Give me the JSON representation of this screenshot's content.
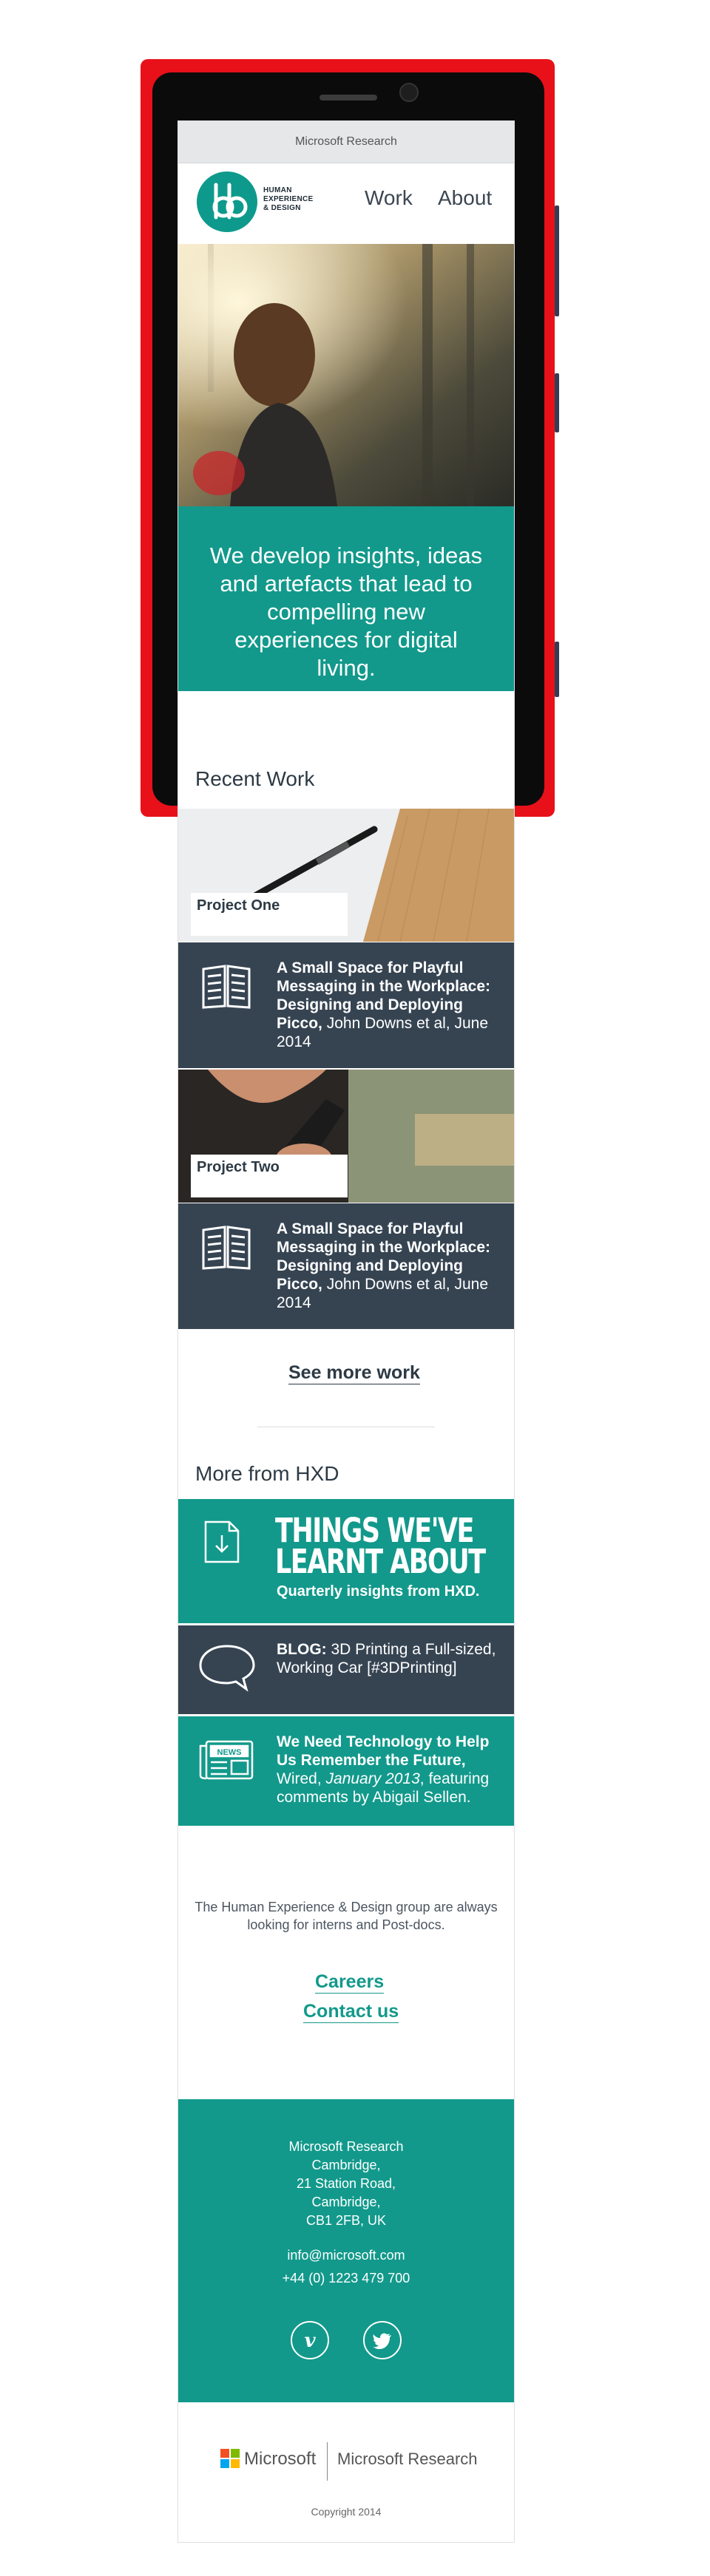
{
  "browser": {
    "title": "Microsoft Research"
  },
  "header": {
    "logo_text": [
      "HUMAN",
      "EXPERIENCE",
      "& DESIGN"
    ],
    "nav": [
      {
        "label": "Work"
      },
      {
        "label": "About"
      }
    ]
  },
  "hero": {
    "tagline": "We develop insights, ideas and artefacts that lead to compelling new experiences for digital living."
  },
  "recent_work": {
    "title": "Recent Work",
    "projects": [
      {
        "label": "Project One",
        "paper_title": "A Small Space for Playful Messaging in the Workplace: Designing and Deploying Picco,",
        "paper_meta": " John Downs et al, June 2014",
        "icon": "book-icon"
      },
      {
        "label": "Project Two",
        "paper_title": "A Small Space for Playful Messaging in the Workplace: Designing and Deploying Picco,",
        "paper_meta": " John Downs et al, June 2014",
        "icon": "book-icon"
      }
    ],
    "see_more": "See more work"
  },
  "more": {
    "title": "More from HXD",
    "things_title_1": "THINGS WE'VE",
    "things_title_2": "LEARNT ABOUT",
    "things_sub": "Quarterly insights from HXD.",
    "blog_label": "BLOG:",
    "blog_text": " 3D Printing a Full-sized, Working Car [#3DPrinting]",
    "news_title": "We Need Technology to Help Us Remember the Future,",
    "news_source": " Wired, ",
    "news_date": "January 2013",
    "news_rest": ", featuring comments by Abigail Sellen.",
    "news_badge": "NEWS"
  },
  "recruiting": {
    "note": "The Human Experience & Design group are always looking for interns and Post-docs.",
    "careers": "Careers",
    "contact": "Contact us"
  },
  "footer": {
    "address": [
      "Microsoft Research",
      "Cambridge,",
      "21 Station Road,",
      "Cambridge,",
      "CB1 2FB, UK"
    ],
    "email": "info@microsoft.com",
    "phone": "+44 (0) 1223 479 700"
  },
  "branding": {
    "microsoft": "Microsoft",
    "research": "Microsoft Research",
    "copyright": "Copyright 2014"
  },
  "colors": {
    "teal": "#12998b",
    "dark": "#364452",
    "phone_red": "#e8111a"
  }
}
